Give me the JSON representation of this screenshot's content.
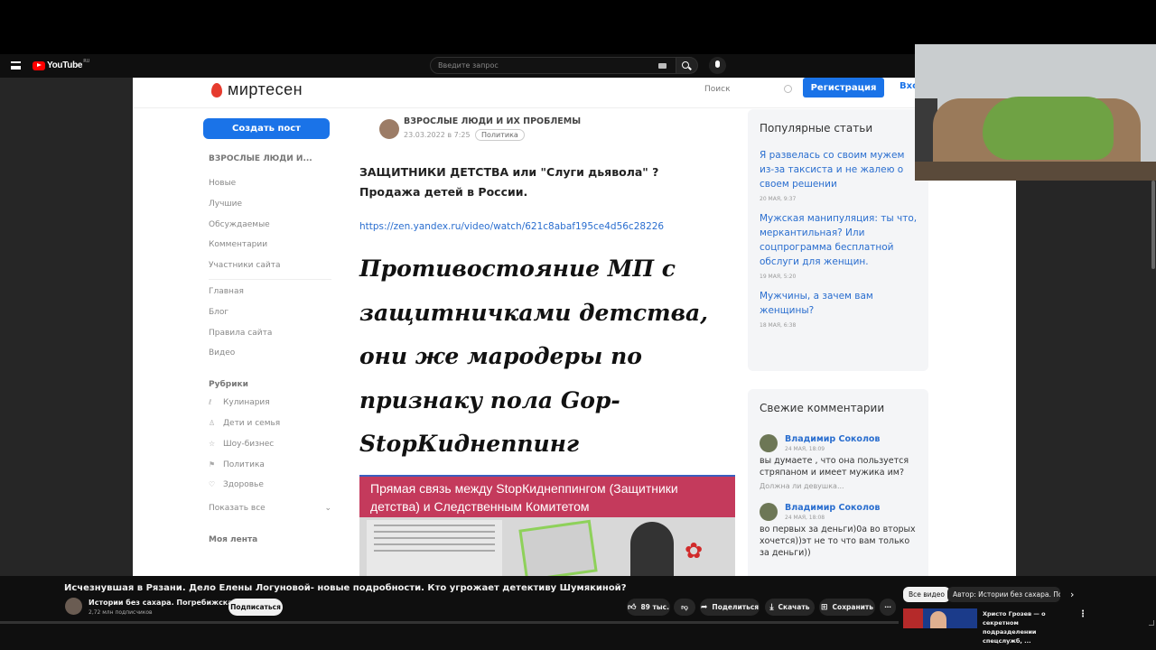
{
  "youtube": {
    "logo_text": "YouTube",
    "region": "RU",
    "search_placeholder": "Введите запрос"
  },
  "site": {
    "brand": "миртесен",
    "search_placeholder": "Поиск",
    "register_label": "Регистрация",
    "login_label": "Вход",
    "create_post_label": "Создать пост"
  },
  "sidebar": {
    "title": "ВЗРОСЛЫЕ ЛЮДИ И...",
    "group1": [
      "Новые",
      "Лучшие",
      "Обсуждаемые",
      "Комментарии",
      "Участники сайта"
    ],
    "group2": [
      "Главная",
      "Блог",
      "Правила сайта",
      "Видео"
    ],
    "rubrics_title": "Рубрики",
    "rubrics": [
      {
        "label": "Кулинария",
        "icon": "spoon-icon"
      },
      {
        "label": "Дети и семья",
        "icon": "family-icon"
      },
      {
        "label": "Шоу-бизнес",
        "icon": "star-icon"
      },
      {
        "label": "Политика",
        "icon": "flag-icon"
      },
      {
        "label": "Здоровье",
        "icon": "heart-icon"
      }
    ],
    "show_all": "Показать все",
    "my_feed": "Моя лента"
  },
  "post": {
    "author": "ВЗРОСЛЫЕ ЛЮДИ И ИХ ПРОБЛЕМЫ",
    "date": "23.03.2022 в 7:25",
    "tag": "Политика",
    "title": "ЗАЩИТНИКИ ДЕТСТВА или \"Слуги дьявола\" ? Продажа детей в России.",
    "link": "https://zen.yandex.ru/video/watch/621c8abaf195ce4d56c28226",
    "big_text": "Противостояние МП с защитничками детства, они же мародеры по признаку пола Gop-StopКиднеппинг",
    "image_banner": "Прямая связь между StopКиднеппингом (Защитники детства) и Следственным Комитетом"
  },
  "popular": {
    "title": "Популярные статьи",
    "items": [
      {
        "title": "Я развелась со своим мужем из-за таксиста и не жалею о своем решении",
        "date": "20 МАЯ, 9:37"
      },
      {
        "title": "Мужская манипуляция: ты что, меркантильная? Или соцпрограмма бесплатной обслуги для женщин.",
        "date": "19 МАЯ, 5:20"
      },
      {
        "title": "Мужчины, а зачем вам женщины?",
        "date": "18 МАЯ, 6:38"
      }
    ]
  },
  "comments": {
    "title": "Свежие комментарии",
    "items": [
      {
        "author": "Владимир Соколов",
        "date": "24 МАЯ, 18:09",
        "text": "вы думаете , что она пользуется стряпаном и имеет мужика им?",
        "post": "Должна ли девушка..."
      },
      {
        "author": "Владимир Соколов",
        "date": "24 МАЯ, 18:08",
        "text": "во первых за деньги)0а во вторых хочется))эт не то что вам только за деньги))",
        "post": ""
      }
    ]
  },
  "video": {
    "title": "Исчезнувшая в Рязани. Дело Елены Логуновой- новые подробности. Кто угрожает детективу Шумякиной?",
    "channel": "Истории без сахара. Погребижская.",
    "subscribers": "2,72 млн подписчиков",
    "subscribe_label": "Подписаться",
    "likes": "89 тыс.",
    "share_label": "Поделиться",
    "download_label": "Скачать",
    "save_label": "Сохранить"
  },
  "recommend": {
    "chip_all": "Все видео",
    "chip_author": "Автор: Истории без сахара. Погребижская",
    "title": "Христо Грозев — о секретном подразделении спецслужб, ..."
  }
}
